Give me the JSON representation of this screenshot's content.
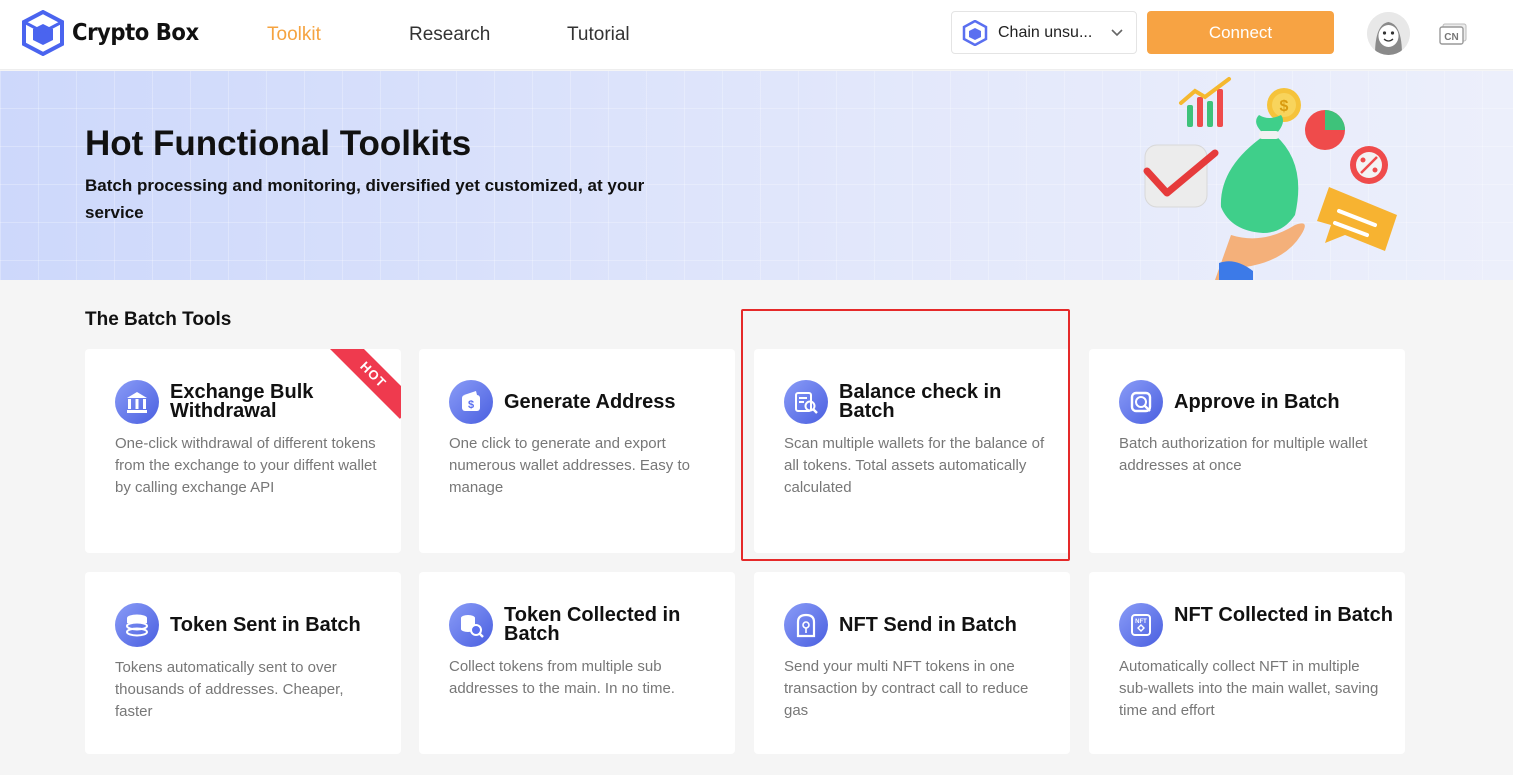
{
  "header": {
    "app_name": "Crypto Box",
    "nav": [
      "Toolkit",
      "Research",
      "Tutorial"
    ],
    "chain_select": "Chain unsu...",
    "connect_label": "Connect",
    "lang_label": "CN"
  },
  "banner": {
    "title": "Hot Functional Toolkits",
    "subtitle": "Batch processing and monitoring, diversified yet customized, at your service"
  },
  "section": {
    "title": "The Batch Tools"
  },
  "cards": [
    {
      "title": "Exchange Bulk Withdrawal",
      "desc": "One-click withdrawal of different tokens from the exchange to your diffent wallet by calling exchange API",
      "badge": "HOT",
      "icon": "exchange-icon"
    },
    {
      "title": "Generate Address",
      "desc": "One click to generate and export numerous wallet addresses. Easy to manage",
      "icon": "wallet-icon"
    },
    {
      "title": "Balance check in Batch",
      "desc": "Scan multiple wallets for the balance of all tokens. Total assets automatically calculated",
      "icon": "balance-search-icon"
    },
    {
      "title": "Approve in Batch",
      "desc": "Batch authorization for multiple wallet addresses at once",
      "icon": "approve-icon"
    },
    {
      "title": "Token Sent in Batch",
      "desc": "Tokens automatically sent to over thousands of addresses. Cheaper, faster",
      "icon": "token-send-icon"
    },
    {
      "title": "Token Collected in Batch",
      "desc": "Collect tokens from multiple sub addresses to the main. In no time.",
      "icon": "token-collect-icon"
    },
    {
      "title": "NFT Send in Batch",
      "desc": "Send your multi NFT tokens in one transaction by contract call to reduce gas",
      "icon": "nft-send-icon"
    },
    {
      "title": "NFT Collected in Batch",
      "desc": "Automatically collect NFT in multiple sub-wallets into the main wallet, saving time and effort",
      "icon": "nft-collect-icon"
    }
  ],
  "colors": {
    "accent": "#f7a343",
    "primary": "#4a5fe0",
    "highlight": "#e52929",
    "hot": "#ef3a4e"
  }
}
